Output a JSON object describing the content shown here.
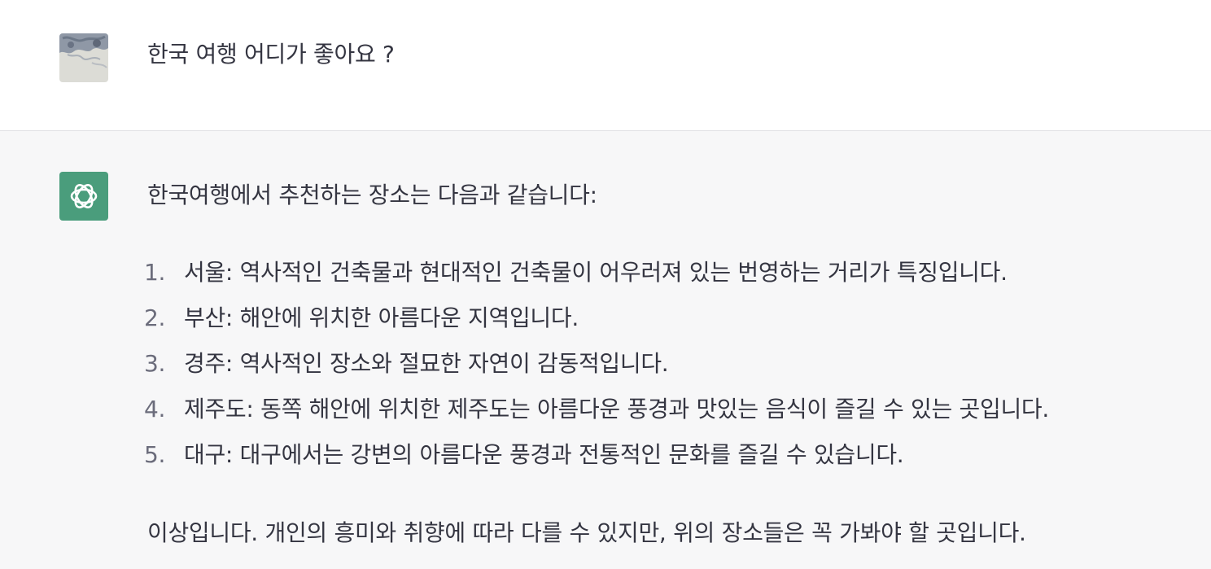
{
  "conversation": {
    "user_message": {
      "avatar_icon": "user-photo-avatar",
      "text": "한국 여행 어디가 좋아요 ?"
    },
    "assistant_message": {
      "avatar_icon": "openai-logo-icon",
      "avatar_color": "#4a9d7c",
      "intro": "한국여행에서 추천하는 장소는 다음과 같습니다:",
      "items": [
        {
          "num": "1.",
          "text": "서울: 역사적인 건축물과 현대적인 건축물이 어우러져 있는 번영하는 거리가 특징입니다."
        },
        {
          "num": "2.",
          "text": "부산: 해안에 위치한 아름다운 지역입니다."
        },
        {
          "num": "3.",
          "text": "경주: 역사적인 장소와 절묘한 자연이 감동적입니다."
        },
        {
          "num": "4.",
          "text": "제주도: 동쪽 해안에 위치한 제주도는 아름다운 풍경과 맛있는 음식이 즐길 수 있는 곳입니다."
        },
        {
          "num": "5.",
          "text": "대구: 대구에서는 강변의 아름다운 풍경과 전통적인 문화를 즐길 수 있습니다."
        }
      ],
      "outro": "이상입니다. 개인의 흥미와 취향에 따라 다를 수 있지만, 위의 장소들은 꼭 가봐야 할 곳입니다."
    }
  }
}
